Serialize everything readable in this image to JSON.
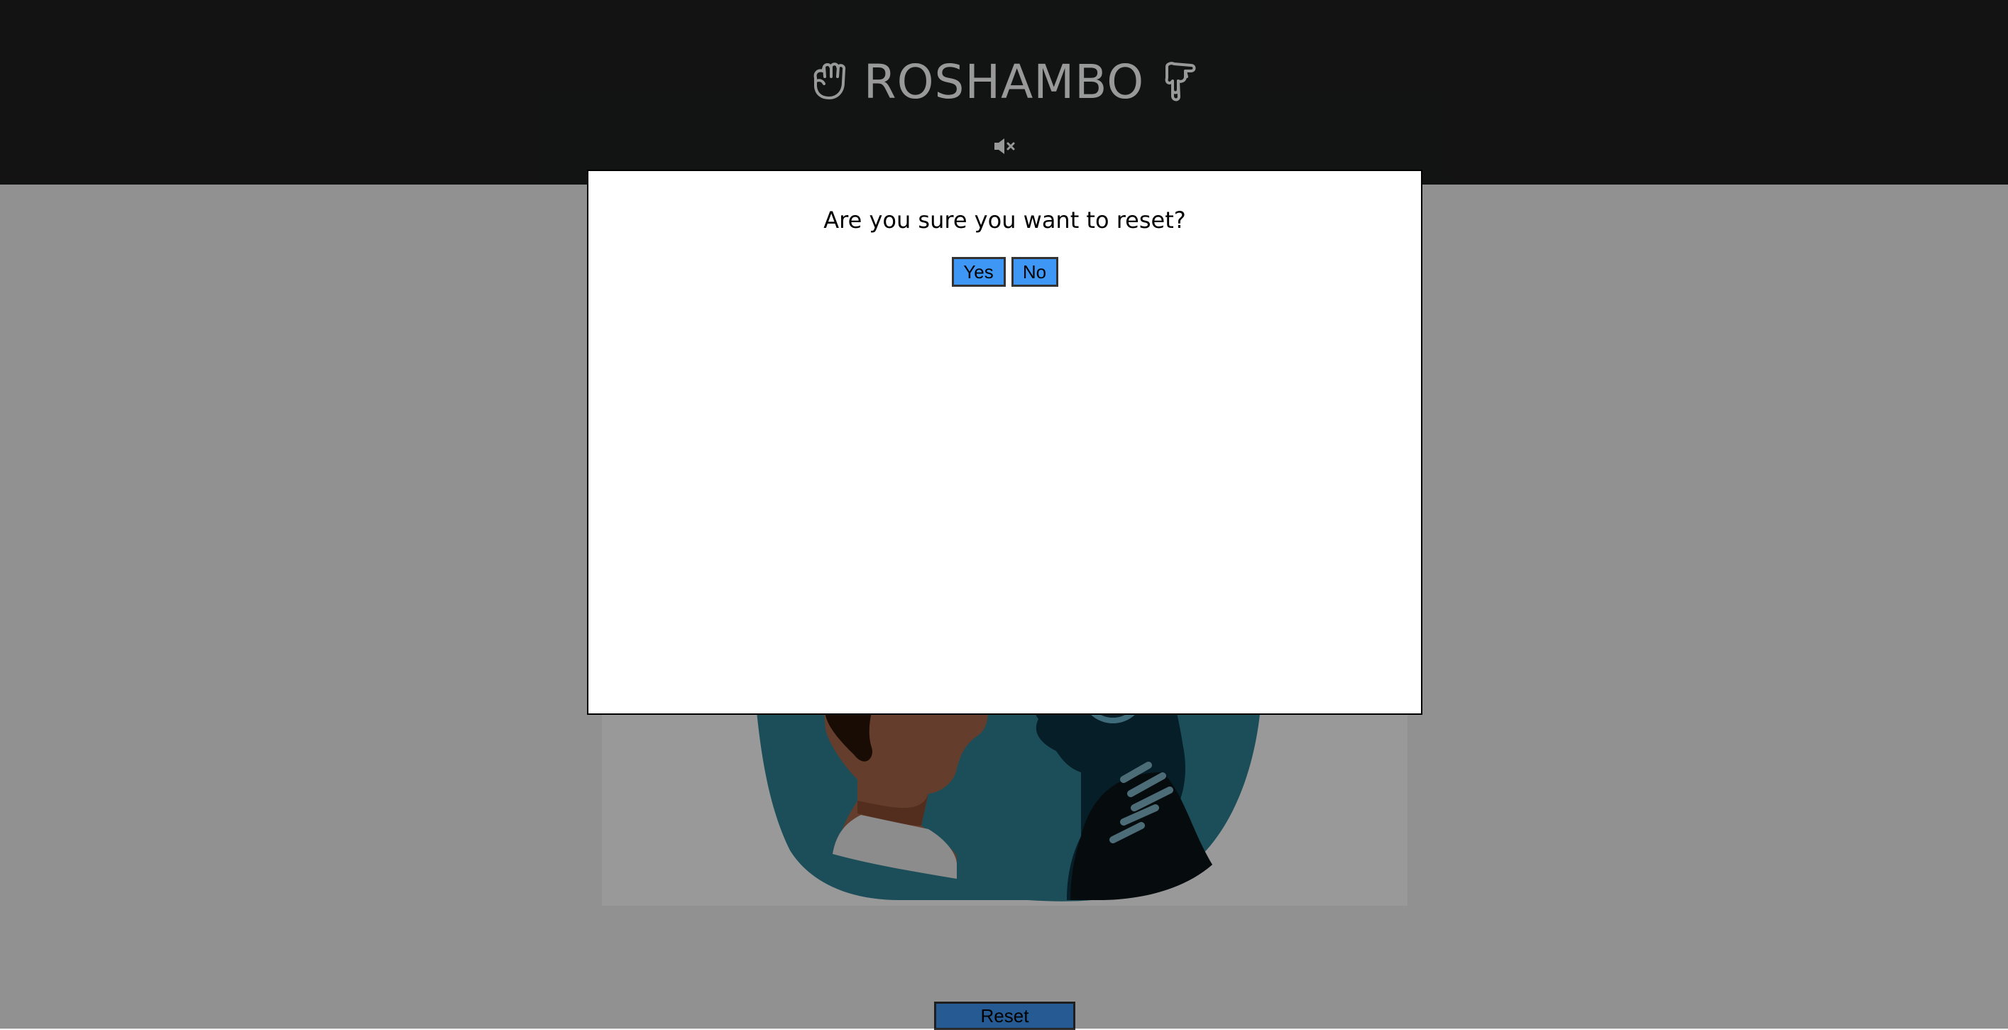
{
  "header": {
    "title": "ROSHAMBO",
    "left_icon": "rock-fist-icon",
    "right_icon": "scissors-hand-icon",
    "mute_icon": "speaker-muted-icon",
    "background_color": "#1f2020",
    "title_color": "#ffffff"
  },
  "stage": {
    "illustration": "human-vs-robot-illustration"
  },
  "controls": {
    "reset_label": "Reset",
    "button_color": "#3f97f5"
  },
  "dialog": {
    "question": "Are you sure you want to reset?",
    "yes_label": "Yes",
    "no_label": "No"
  }
}
